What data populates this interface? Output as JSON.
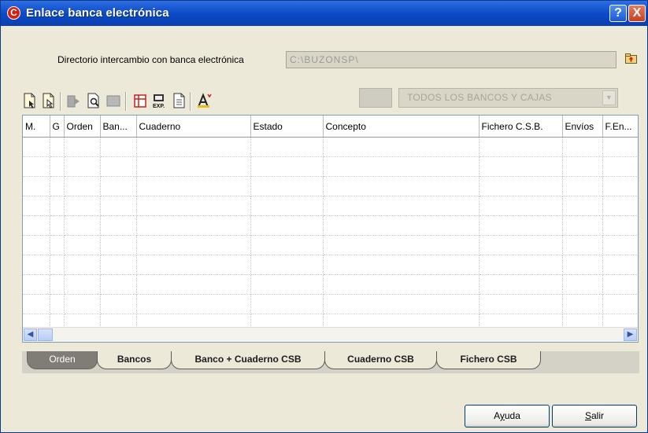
{
  "window": {
    "title": "Enlace banca electrónica",
    "icon_letter": "C",
    "help_glyph": "?",
    "close_glyph": "X"
  },
  "directory": {
    "label": "Directorio intercambio con banca electrónica",
    "value": "C:\\BUZONSP\\"
  },
  "toolbar": {
    "icons": [
      "document-icon",
      "document-cursor-icon",
      "move-icon",
      "preview-icon",
      "grey-box-icon",
      "print-icon",
      "export-icon",
      "page-icon",
      "text-format-icon"
    ]
  },
  "bank_filter": {
    "selected": "TODOS LOS BANCOS Y CAJAS"
  },
  "grid": {
    "columns": [
      "M.",
      "G",
      "Orden",
      "Ban...",
      "Cuaderno",
      "Estado",
      "Concepto",
      "Fichero C.S.B.",
      "Envíos",
      "F.En..."
    ],
    "rows": []
  },
  "tabs": [
    {
      "label": "Orden",
      "active": true
    },
    {
      "label": "Bancos",
      "active": false
    },
    {
      "label": "Banco + Cuaderno CSB",
      "active": false
    },
    {
      "label": "Cuaderno CSB",
      "active": false
    },
    {
      "label": "Fichero CSB",
      "active": false
    }
  ],
  "buttons": {
    "help_prefix": "A",
    "help_mnemonic": "y",
    "help_suffix": "uda",
    "exit_mnemonic": "S",
    "exit_suffix": "alir"
  },
  "colors": {
    "titlebar": "#0b49c4",
    "window_bg": "#ece9d8",
    "active_tab": "#807d76"
  }
}
